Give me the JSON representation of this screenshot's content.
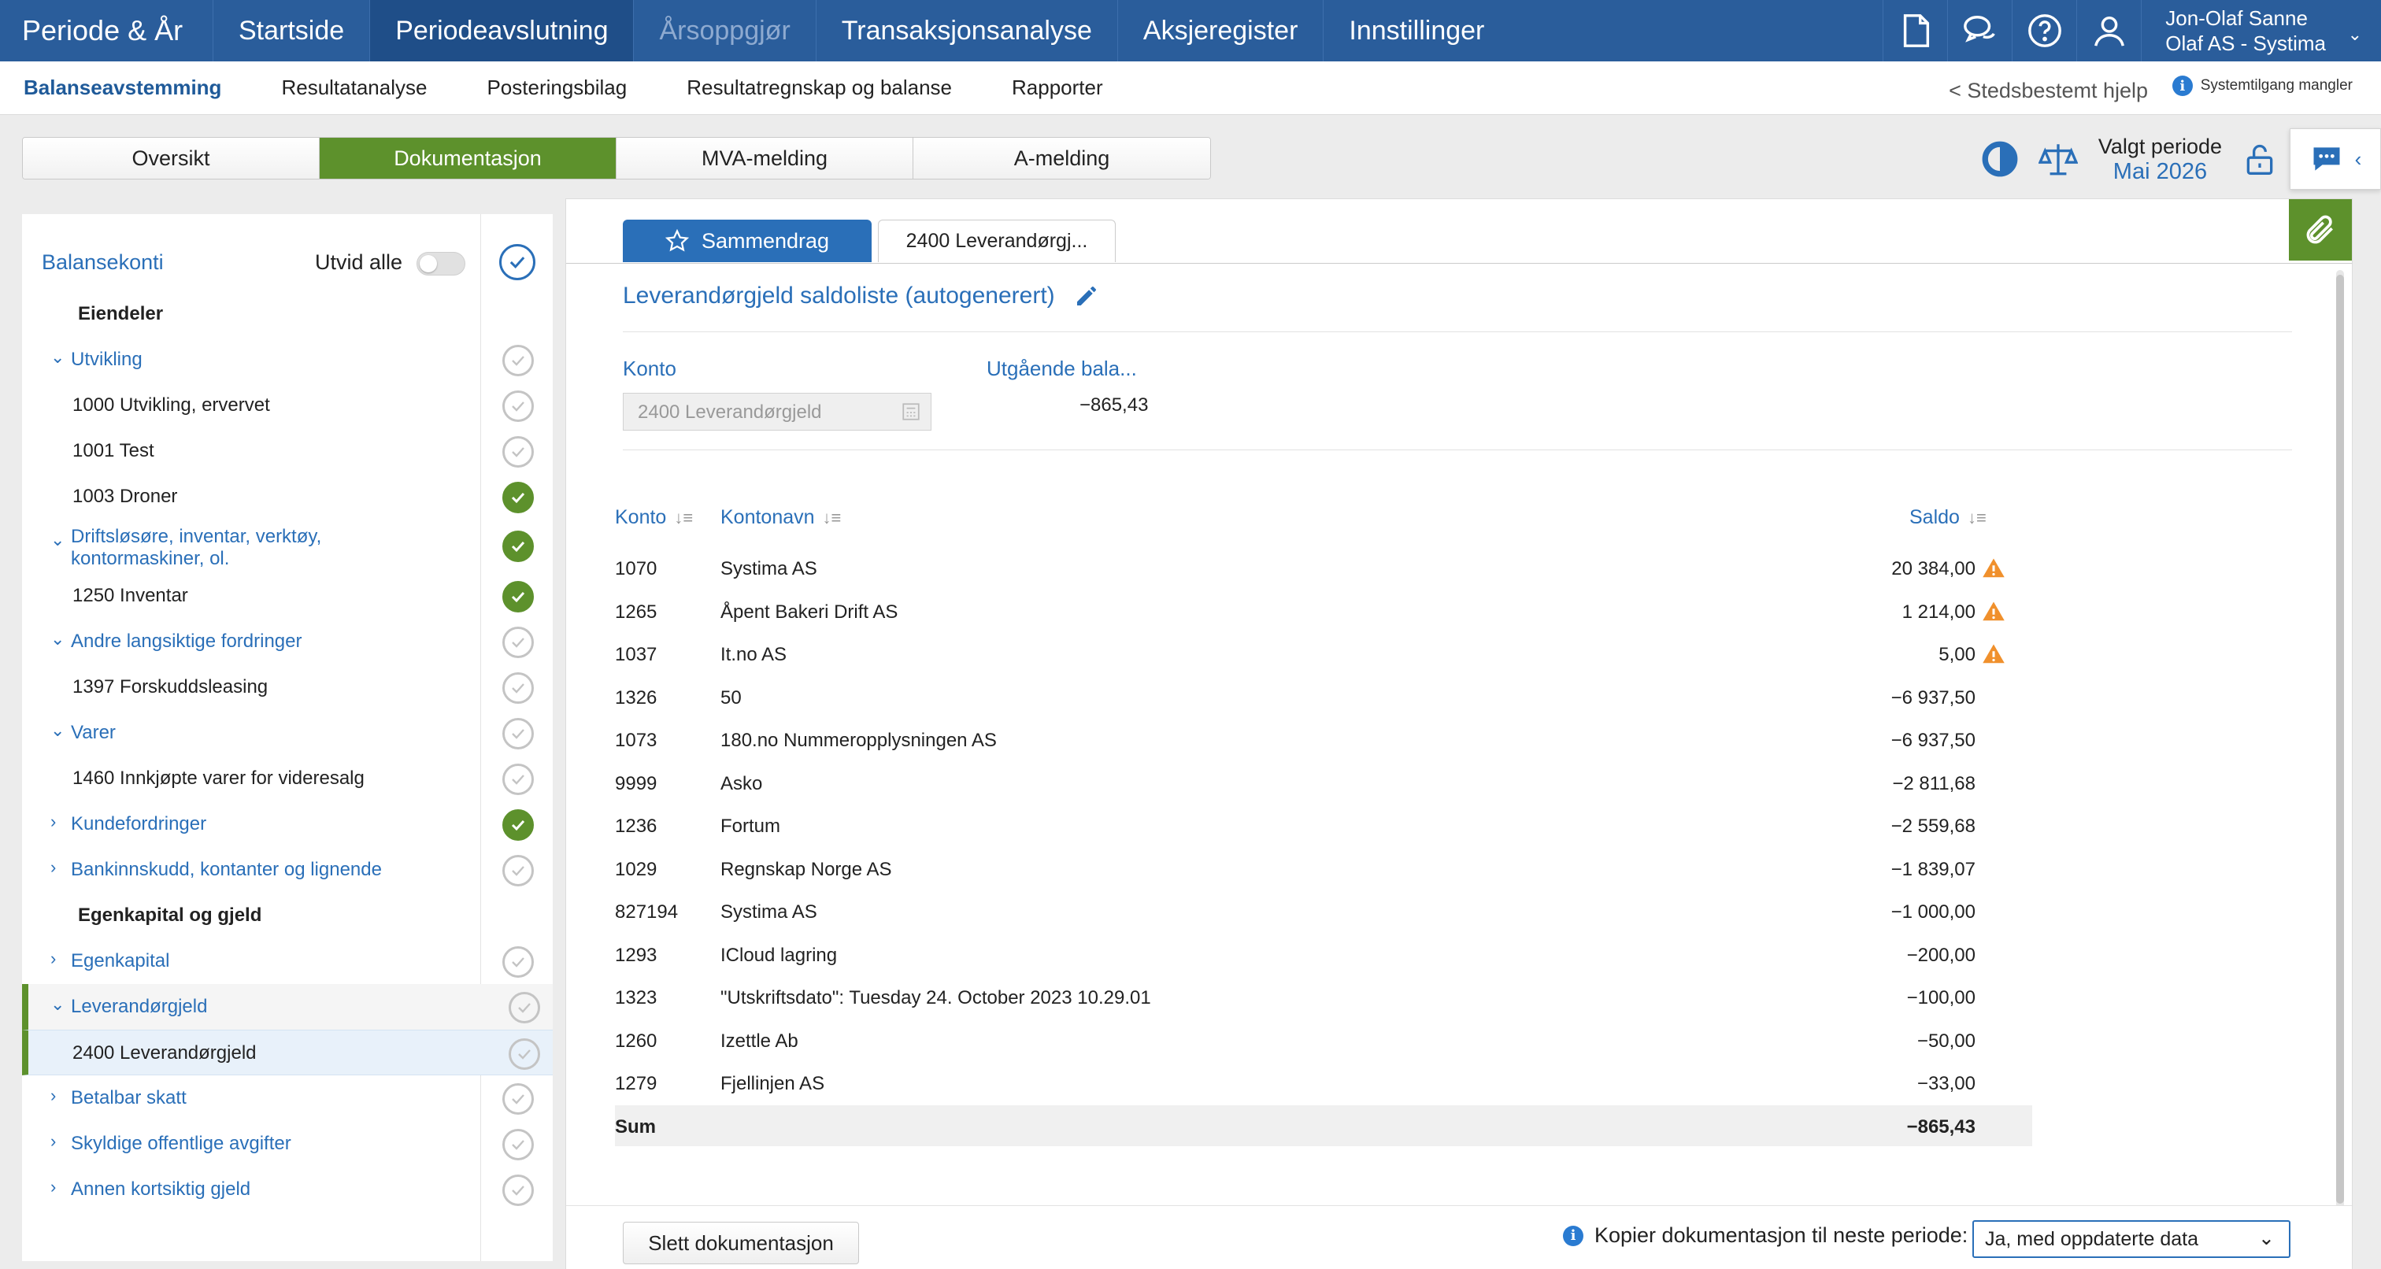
{
  "topnav": {
    "brand": "Periode & År",
    "items": [
      {
        "label": "Startside",
        "state": "normal"
      },
      {
        "label": "Periodeavslutning",
        "state": "active"
      },
      {
        "label": "Årsoppgjør",
        "state": "disabled"
      },
      {
        "label": "Transaksjonsanalyse",
        "state": "normal"
      },
      {
        "label": "Aksjeregister",
        "state": "normal"
      },
      {
        "label": "Innstillinger",
        "state": "normal"
      }
    ],
    "icons": [
      "document-icon",
      "chat-bubbles-icon",
      "help-icon",
      "user-icon"
    ],
    "user_name": "Jon-Olaf Sanne",
    "user_company": "Olaf AS - Systima"
  },
  "subnav": {
    "items": [
      "Balanseavstemming",
      "Resultatanalyse",
      "Posteringsbilag",
      "Resultatregnskap og balanse",
      "Rapporter"
    ],
    "help_link": "< Stedsbestemt hjelp",
    "system_notice": "Systemtilgang mangler"
  },
  "tabs": [
    "Oversikt",
    "Dokumentasjon",
    "MVA-melding",
    "A-melding"
  ],
  "active_tab": "Dokumentasjon",
  "period": {
    "label": "Valgt periode",
    "value": "Mai 2026"
  },
  "left": {
    "title": "Balansekonti",
    "expand_label": "Utvid alle",
    "rows": [
      {
        "label": "Eiendeler",
        "kind": "heading",
        "check": "none"
      },
      {
        "label": "Utvikling",
        "kind": "group",
        "caret": "⌄",
        "check": "empty"
      },
      {
        "label": "1000 Utvikling, ervervet",
        "kind": "leaf",
        "check": "empty"
      },
      {
        "label": "1001 Test",
        "kind": "leaf",
        "check": "empty"
      },
      {
        "label": "1003 Droner",
        "kind": "leaf",
        "check": "done"
      },
      {
        "label": "Driftsløsøre, inventar, verktøy,\nkontormaskiner, ol.",
        "kind": "group",
        "caret": "⌄",
        "check": "done",
        "twoline": true
      },
      {
        "label": "1250 Inventar",
        "kind": "leaf",
        "check": "done"
      },
      {
        "label": "Andre langsiktige fordringer",
        "kind": "group",
        "caret": "⌄",
        "check": "empty"
      },
      {
        "label": "1397 Forskuddsleasing",
        "kind": "leaf",
        "check": "empty"
      },
      {
        "label": "Varer",
        "kind": "group",
        "caret": "⌄",
        "check": "empty"
      },
      {
        "label": "1460 Innkjøpte varer for videresalg",
        "kind": "leaf",
        "check": "empty"
      },
      {
        "label": "Kundefordringer",
        "kind": "group",
        "caret": "›",
        "check": "done"
      },
      {
        "label": "Bankinnskudd, kontanter og lignende",
        "kind": "group",
        "caret": "›",
        "check": "empty"
      },
      {
        "label": "Egenkapital og gjeld",
        "kind": "heading",
        "check": "none"
      },
      {
        "label": "Egenkapital",
        "kind": "group",
        "caret": "›",
        "check": "empty"
      },
      {
        "label": "Leverandørgjeld",
        "kind": "group",
        "caret": "⌄",
        "check": "empty",
        "state": "selgroup"
      },
      {
        "label": "2400 Leverandørgjeld",
        "kind": "leaf",
        "check": "empty",
        "state": "selected"
      },
      {
        "label": "Betalbar skatt",
        "kind": "group",
        "caret": "›",
        "check": "empty"
      },
      {
        "label": "Skyldige offentlige avgifter",
        "kind": "group",
        "caret": "›",
        "check": "empty"
      },
      {
        "label": "Annen kortsiktig gjeld",
        "kind": "group",
        "caret": "›",
        "check": "empty"
      }
    ]
  },
  "main": {
    "tab_summary": "Sammendrag",
    "tab_doc": "2400 Leverandørgj...",
    "title": "Leverandørgjeld saldoliste (autogenerert)",
    "konto_label": "Konto",
    "konto_value": "2400 Leverandørgjeld",
    "utg_label": "Utgående bala...",
    "utg_value": "−865,43",
    "columns": [
      "Konto",
      "Kontonavn",
      "Saldo"
    ],
    "rows": [
      {
        "konto": "1070",
        "navn": "Systima AS",
        "saldo": "20 384,00",
        "warn": true
      },
      {
        "konto": "1265",
        "navn": "Åpent Bakeri Drift AS",
        "saldo": "1 214,00",
        "warn": true
      },
      {
        "konto": "1037",
        "navn": "It.no AS",
        "saldo": "5,00",
        "warn": true
      },
      {
        "konto": "1326",
        "navn": "50",
        "saldo": "−6 937,50",
        "warn": false
      },
      {
        "konto": "1073",
        "navn": "180.no Nummeropplysningen AS",
        "saldo": "−6 937,50",
        "warn": false
      },
      {
        "konto": "9999",
        "navn": "Asko",
        "saldo": "−2 811,68",
        "warn": false
      },
      {
        "konto": "1236",
        "navn": "Fortum",
        "saldo": "−2 559,68",
        "warn": false
      },
      {
        "konto": "1029",
        "navn": "Regnskap Norge AS",
        "saldo": "−1 839,07",
        "warn": false
      },
      {
        "konto": "827194",
        "navn": "Systima AS",
        "saldo": "−1 000,00",
        "warn": false
      },
      {
        "konto": "1293",
        "navn": "ICloud lagring",
        "saldo": "−200,00",
        "warn": false
      },
      {
        "konto": "1323",
        "navn": "\"Utskriftsdato\": Tuesday 24. October 2023 10.29.01",
        "saldo": "−100,00",
        "warn": false
      },
      {
        "konto": "1260",
        "navn": "Izettle Ab",
        "saldo": "−50,00",
        "warn": false
      },
      {
        "konto": "1279",
        "navn": "Fjellinjen AS",
        "saldo": "−33,00",
        "warn": false
      }
    ],
    "sum_label": "Sum",
    "sum_value": "−865,43",
    "delete_label": "Slett dokumentasjon",
    "copy_label": "Kopier dokumentasjon til neste periode:",
    "copy_selected": "Ja, med oppdaterte data"
  },
  "colors": {
    "nav": "#2a5d9b",
    "accent": "#2a6fb8",
    "green": "#5d912c",
    "warning": "#f0902c"
  }
}
